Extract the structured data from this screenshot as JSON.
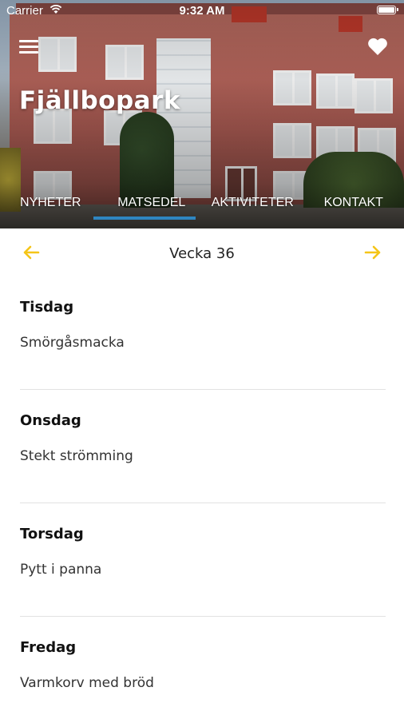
{
  "status_bar": {
    "carrier": "Carrier",
    "time": "9:32 AM"
  },
  "header": {
    "title": "Fjällbopark",
    "menu_icon": "hamburger-menu-icon",
    "favorite_icon": "heart-icon"
  },
  "tabs": [
    {
      "label": "NYHETER"
    },
    {
      "label": "MATSEDEL",
      "active": true
    },
    {
      "label": "AKTIVITETER"
    },
    {
      "label": "KONTAKT"
    }
  ],
  "colors": {
    "accent_arrow": "#F5C518",
    "tab_indicator": "#2E86C1"
  },
  "week_nav": {
    "label": "Vecka 36",
    "prev_icon": "arrow-left-icon",
    "next_icon": "arrow-right-icon"
  },
  "menu": [
    {
      "day": "Tisdag",
      "dish": "Smörgåsmacka"
    },
    {
      "day": "Onsdag",
      "dish": "Stekt strömming"
    },
    {
      "day": "Torsdag",
      "dish": "Pytt i panna"
    },
    {
      "day": "Fredag",
      "dish": "Varmkorv med bröd"
    }
  ]
}
